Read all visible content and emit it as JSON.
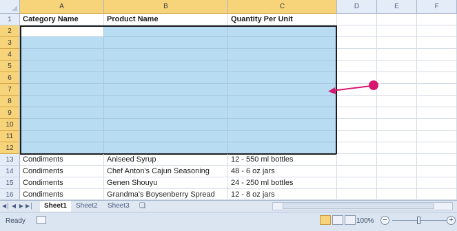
{
  "columns": [
    "A",
    "B",
    "C",
    "D",
    "E",
    "F"
  ],
  "header_row": {
    "num": "1",
    "cells": [
      "Category Name",
      "Product Name",
      "Quantity Per Unit"
    ]
  },
  "selected_rows": [
    "2",
    "3",
    "4",
    "5",
    "6",
    "7",
    "8",
    "9",
    "10",
    "11",
    "12"
  ],
  "data_rows": [
    {
      "num": "13",
      "category": "Condiments",
      "product": "Aniseed Syrup",
      "quantity": "12 - 550 ml bottles"
    },
    {
      "num": "14",
      "category": "Condiments",
      "product": "Chef Anton's Cajun Seasoning",
      "quantity": "48 - 6 oz jars"
    },
    {
      "num": "15",
      "category": "Condiments",
      "product": "Genen Shouyu",
      "quantity": "24 - 250 ml bottles"
    },
    {
      "num": "16",
      "category": "Condiments",
      "product": "Grandma's Boysenberry Spread",
      "quantity": "12 - 8 oz jars"
    }
  ],
  "sheet_tabs": [
    "Sheet1",
    "Sheet2",
    "Sheet3"
  ],
  "active_sheet": "Sheet1",
  "status": {
    "ready_label": "Ready",
    "zoom_label": "100%"
  },
  "colors": {
    "selection_fill": "#b8dcf2",
    "header_selected": "#f7d37a",
    "callout": "#d6166f"
  },
  "icons": [
    "nav-first-icon",
    "nav-prev-icon",
    "nav-next-icon",
    "nav-last-icon",
    "insert-sheet-icon",
    "macro-record-icon",
    "normal-view-icon",
    "page-layout-icon",
    "page-break-icon",
    "zoom-out-icon",
    "zoom-in-icon",
    "callout-arrow-icon"
  ]
}
